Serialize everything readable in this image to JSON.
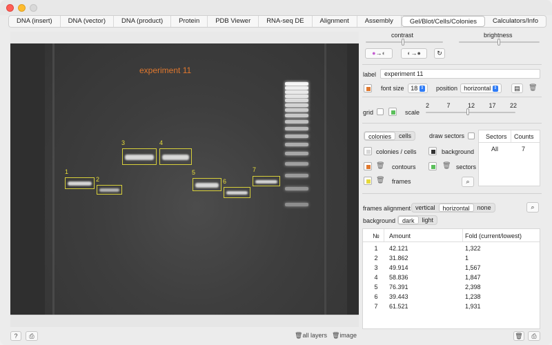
{
  "tabs": [
    "DNA (insert)",
    "DNA (vector)",
    "DNA (product)",
    "Protein",
    "PDB Viewer",
    "RNA-seq DE",
    "Alignment",
    "Assembly",
    "Gel/Blot/Cells/Colonies",
    "Calculators/Info"
  ],
  "active_tab_index": 8,
  "image": {
    "title_label": "experiment 11",
    "title_color": "#e0782e",
    "band_labels": [
      "1",
      "2",
      "3",
      "4",
      "5",
      "6",
      "7"
    ]
  },
  "adjust": {
    "contrast_label": "contrast",
    "brightness_label": "brightness",
    "contrast_level": 0.5,
    "brightness_level": 0.6
  },
  "label_section": {
    "label_caption": "label",
    "label_value": "experiment 11",
    "font_size_caption": "font size",
    "font_size_value": "18",
    "position_caption": "position",
    "position_value": "horizontal",
    "label_color": "#e0782e"
  },
  "grid_section": {
    "grid_caption": "grid",
    "grid_checked": false,
    "grid_color": "#5cbf5c",
    "scale_caption": "scale",
    "scale_ticks": [
      "2",
      "7",
      "12",
      "17",
      "22"
    ],
    "scale_value": 12
  },
  "mode": {
    "options": [
      "colonies",
      "cells"
    ],
    "selected": "colonies",
    "draw_sectors_label": "draw sectors",
    "draw_sectors_checked": false
  },
  "layers": {
    "colonies_cells_label": "colonies / cells",
    "background_label": "background",
    "contours_label": "contours",
    "sectors_label": "sectors",
    "frames_label": "frames",
    "contours_color": "#e0782e",
    "sectors_color": "#5cbf5c",
    "frames_color": "#e5d93a",
    "background_color": "#333333"
  },
  "sectors_table": {
    "headers": [
      "Sectors",
      "Counts"
    ],
    "rows": [
      [
        "All",
        "7"
      ]
    ]
  },
  "frames_alignment": {
    "caption": "frames alignment",
    "options": [
      "vertical",
      "horizontal",
      "none"
    ],
    "selected": "horizontal"
  },
  "background": {
    "caption": "background",
    "options": [
      "dark",
      "light"
    ],
    "selected": "dark"
  },
  "results": {
    "headers": [
      "№",
      "Amount",
      "Fold (current/lowest)"
    ],
    "rows": [
      [
        "1",
        "42.121",
        "1,322"
      ],
      [
        "2",
        "31.862",
        "1"
      ],
      [
        "3",
        "49.914",
        "1,567"
      ],
      [
        "4",
        "58.836",
        "1,847"
      ],
      [
        "5",
        "76.391",
        "2,398"
      ],
      [
        "6",
        "39.443",
        "1,238"
      ],
      [
        "7",
        "61.521",
        "1,931"
      ]
    ]
  },
  "footer": {
    "all_layers": "all layers",
    "image": "image",
    "help": "?"
  }
}
